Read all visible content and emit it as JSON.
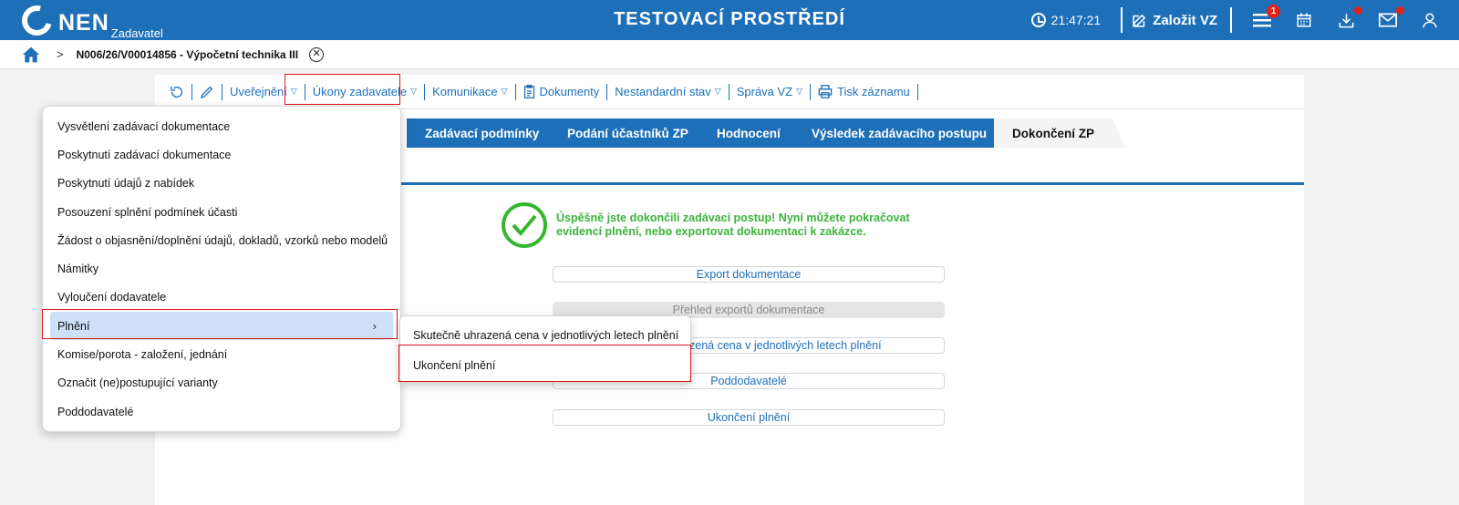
{
  "header": {
    "logo_text": "NEN",
    "logo_sub": "Zadavatel",
    "env_title": "TESTOVACÍ PROSTŘEDÍ",
    "time": "21:47:21",
    "create_label": "Založit VZ",
    "menu_badge": "1",
    "brand_color": "#1d6fb8"
  },
  "breadcrumb": {
    "title": "N006/26/V00014856 - Výpočetní technika III"
  },
  "toolbar": {
    "items": [
      "Uveřejnění",
      "Úkony zadavatele",
      "Komunikace",
      "Dokumenty",
      "Nestandardní stav",
      "Správa VZ",
      "Tisk záznamu"
    ]
  },
  "tabs": [
    "Zadávací podmínky",
    "Podání účastníků ZP",
    "Hodnocení",
    "Výsledek zadávacího postupu",
    "Dokončení ZP"
  ],
  "content": {
    "success_message": "Úspěšně jste dokončili zadávací postup! Nyní můžete pokračovat evidencí plnění, nebo exportovat dokumentaci k zakázce.",
    "buttons": [
      "Export dokumentace",
      "Přehled exportů dokumentace",
      "Skutečně uhrazená cena v jednotlivých letech plnění",
      "Poddodavatelé",
      "Ukončení plnění"
    ]
  },
  "menu": {
    "items": [
      "Vysvětlení zadávací dokumentace",
      "Poskytnutí zadávací dokumentace",
      "Poskytnutí údajů z nabídek",
      "Posouzení splnění podmínek účasti",
      "Žádost o objasnění/doplnění údajů, dokladů, vzorků nebo modelů",
      "Námitky",
      "Vyloučení dodavatele",
      "Plnění",
      "Komise/porota - založení, jednání",
      "Označit (ne)postupující varianty",
      "Poddodavatelé"
    ]
  },
  "submenu": {
    "items": [
      "Skutečně uhrazená cena v jednotlivých letech plnění",
      "Ukončení plnění"
    ]
  }
}
